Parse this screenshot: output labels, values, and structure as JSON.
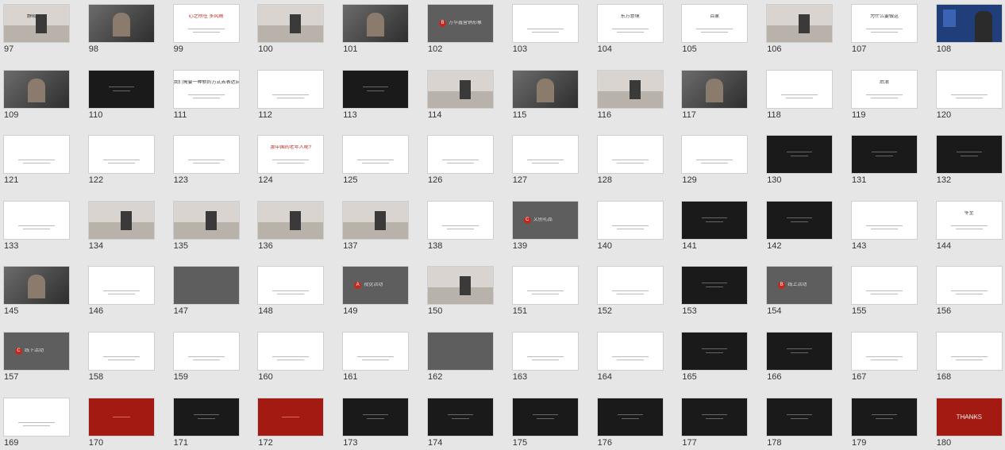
{
  "slides": [
    {
      "n": "97",
      "kind": "mist",
      "title": "静观天下"
    },
    {
      "n": "98",
      "kind": "photo",
      "title": ""
    },
    {
      "n": "99",
      "kind": "white",
      "title": "心之所往 多风雨",
      "titleColor": "red"
    },
    {
      "n": "100",
      "kind": "mist",
      "title": ""
    },
    {
      "n": "101",
      "kind": "photo",
      "title": ""
    },
    {
      "n": "102",
      "kind": "gray",
      "title": "方华鑫营销形象",
      "badge": "B"
    },
    {
      "n": "103",
      "kind": "white",
      "title": ""
    },
    {
      "n": "104",
      "kind": "white",
      "title": "东方意境"
    },
    {
      "n": "105",
      "kind": "white",
      "title": "百家"
    },
    {
      "n": "106",
      "kind": "mist",
      "title": ""
    },
    {
      "n": "107",
      "kind": "white",
      "title": "为什么要做这"
    },
    {
      "n": "108",
      "kind": "blue",
      "title": ""
    },
    {
      "n": "109",
      "kind": "photo",
      "title": ""
    },
    {
      "n": "110",
      "kind": "dark",
      "title": ""
    },
    {
      "n": "111",
      "kind": "white",
      "title": "我们需要一种新的方式去表达自我"
    },
    {
      "n": "112",
      "kind": "white",
      "title": ""
    },
    {
      "n": "113",
      "kind": "dark",
      "title": ""
    },
    {
      "n": "114",
      "kind": "mist",
      "title": ""
    },
    {
      "n": "115",
      "kind": "photo",
      "title": ""
    },
    {
      "n": "116",
      "kind": "mist",
      "title": ""
    },
    {
      "n": "117",
      "kind": "photo",
      "title": ""
    },
    {
      "n": "118",
      "kind": "white",
      "title": ""
    },
    {
      "n": "119",
      "kind": "white",
      "title": "后浪"
    },
    {
      "n": "120",
      "kind": "white",
      "title": ""
    },
    {
      "n": "121",
      "kind": "white",
      "title": ""
    },
    {
      "n": "122",
      "kind": "white",
      "title": ""
    },
    {
      "n": "123",
      "kind": "white",
      "title": ""
    },
    {
      "n": "124",
      "kind": "white",
      "title": "那中国的老年人呢?",
      "titleColor": "red"
    },
    {
      "n": "125",
      "kind": "white",
      "title": ""
    },
    {
      "n": "126",
      "kind": "white",
      "title": ""
    },
    {
      "n": "127",
      "kind": "white",
      "title": ""
    },
    {
      "n": "128",
      "kind": "white",
      "title": ""
    },
    {
      "n": "129",
      "kind": "white",
      "title": ""
    },
    {
      "n": "130",
      "kind": "dark",
      "title": ""
    },
    {
      "n": "131",
      "kind": "dark",
      "title": ""
    },
    {
      "n": "132",
      "kind": "dark",
      "title": ""
    },
    {
      "n": "133",
      "kind": "white",
      "title": ""
    },
    {
      "n": "134",
      "kind": "mist",
      "title": ""
    },
    {
      "n": "135",
      "kind": "mist",
      "title": ""
    },
    {
      "n": "136",
      "kind": "mist",
      "title": ""
    },
    {
      "n": "137",
      "kind": "mist",
      "title": ""
    },
    {
      "n": "138",
      "kind": "white",
      "title": ""
    },
    {
      "n": "139",
      "kind": "gray",
      "title": "文创礼品",
      "badge": "C"
    },
    {
      "n": "140",
      "kind": "white",
      "title": ""
    },
    {
      "n": "141",
      "kind": "dark",
      "title": ""
    },
    {
      "n": "142",
      "kind": "dark",
      "title": ""
    },
    {
      "n": "143",
      "kind": "white",
      "title": ""
    },
    {
      "n": "144",
      "kind": "white",
      "title": "冬至"
    },
    {
      "n": "145",
      "kind": "photo",
      "title": ""
    },
    {
      "n": "146",
      "kind": "white",
      "title": ""
    },
    {
      "n": "147",
      "kind": "gray",
      "title": ""
    },
    {
      "n": "148",
      "kind": "white",
      "title": ""
    },
    {
      "n": "149",
      "kind": "gray",
      "title": "视觉活动",
      "badge": "A"
    },
    {
      "n": "150",
      "kind": "mist",
      "title": ""
    },
    {
      "n": "151",
      "kind": "white",
      "title": ""
    },
    {
      "n": "152",
      "kind": "white",
      "title": ""
    },
    {
      "n": "153",
      "kind": "dark",
      "title": ""
    },
    {
      "n": "154",
      "kind": "gray",
      "title": "线上活动",
      "badge": "B"
    },
    {
      "n": "155",
      "kind": "white",
      "title": ""
    },
    {
      "n": "156",
      "kind": "white",
      "title": ""
    },
    {
      "n": "157",
      "kind": "gray",
      "title": "线下活动",
      "badge": "C"
    },
    {
      "n": "158",
      "kind": "white",
      "title": ""
    },
    {
      "n": "159",
      "kind": "white",
      "title": ""
    },
    {
      "n": "160",
      "kind": "white",
      "title": ""
    },
    {
      "n": "161",
      "kind": "white",
      "title": ""
    },
    {
      "n": "162",
      "kind": "gray",
      "title": ""
    },
    {
      "n": "163",
      "kind": "white",
      "title": ""
    },
    {
      "n": "164",
      "kind": "white",
      "title": ""
    },
    {
      "n": "165",
      "kind": "dark",
      "title": ""
    },
    {
      "n": "166",
      "kind": "dark",
      "title": ""
    },
    {
      "n": "167",
      "kind": "white",
      "title": ""
    },
    {
      "n": "168",
      "kind": "white",
      "title": ""
    },
    {
      "n": "169",
      "kind": "white",
      "title": ""
    },
    {
      "n": "170",
      "kind": "red",
      "title": ""
    },
    {
      "n": "171",
      "kind": "dark",
      "title": ""
    },
    {
      "n": "172",
      "kind": "red",
      "title": ""
    },
    {
      "n": "173",
      "kind": "dark",
      "title": ""
    },
    {
      "n": "174",
      "kind": "dark",
      "title": ""
    },
    {
      "n": "175",
      "kind": "dark",
      "title": ""
    },
    {
      "n": "176",
      "kind": "dark",
      "title": ""
    },
    {
      "n": "177",
      "kind": "dark",
      "title": ""
    },
    {
      "n": "178",
      "kind": "dark",
      "title": ""
    },
    {
      "n": "179",
      "kind": "dark",
      "title": ""
    },
    {
      "n": "180",
      "kind": "red",
      "title": "THANKS"
    }
  ],
  "colors": {
    "background": "#e6e6e6",
    "accent": "#c4281c",
    "gray_slide": "#5e5e5e",
    "dark_slide": "#1a1a1a",
    "red_slide": "#a31a12"
  }
}
